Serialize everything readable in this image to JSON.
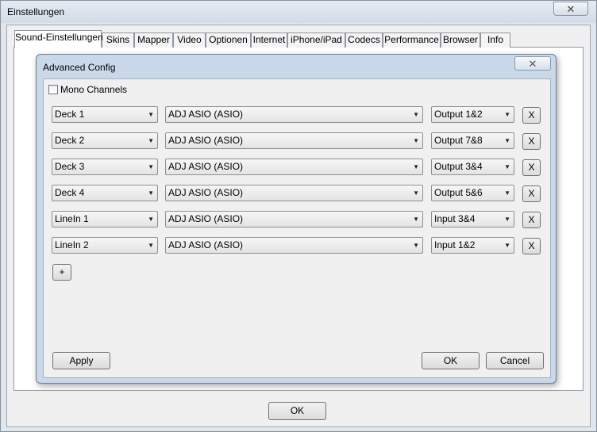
{
  "window": {
    "title": "Einstellungen",
    "close_label": "✕"
  },
  "tabs": [
    "Sound-Einstellungen",
    "Skins",
    "Mapper",
    "Video",
    "Optionen",
    "Internet",
    "iPhone/iPad",
    "Codecs",
    "Performance",
    "Browser",
    "Info"
  ],
  "dialog": {
    "title": "Advanced Config",
    "close_label": "✕",
    "mono_label": "Mono Channels",
    "rows": [
      {
        "deck": "Deck 1",
        "device": "ADJ ASIO (ASIO)",
        "channel": "Output 1&2",
        "remove_label": "X"
      },
      {
        "deck": "Deck 2",
        "device": "ADJ ASIO (ASIO)",
        "channel": "Output 7&8",
        "remove_label": "X"
      },
      {
        "deck": "Deck 3",
        "device": "ADJ ASIO (ASIO)",
        "channel": "Output 3&4",
        "remove_label": "X"
      },
      {
        "deck": "Deck 4",
        "device": "ADJ ASIO (ASIO)",
        "channel": "Output 5&6",
        "remove_label": "X"
      },
      {
        "deck": "LineIn 1",
        "device": "ADJ ASIO (ASIO)",
        "channel": "Input 3&4",
        "remove_label": "X"
      },
      {
        "deck": "LineIn 2",
        "device": "ADJ ASIO (ASIO)",
        "channel": "Input 1&2",
        "remove_label": "X"
      }
    ],
    "add_label": "+",
    "apply_label": "Apply",
    "ok_label": "OK",
    "cancel_label": "Cancel",
    "dropdown_arrow": "▼"
  },
  "footer": {
    "ok_label": "OK"
  }
}
